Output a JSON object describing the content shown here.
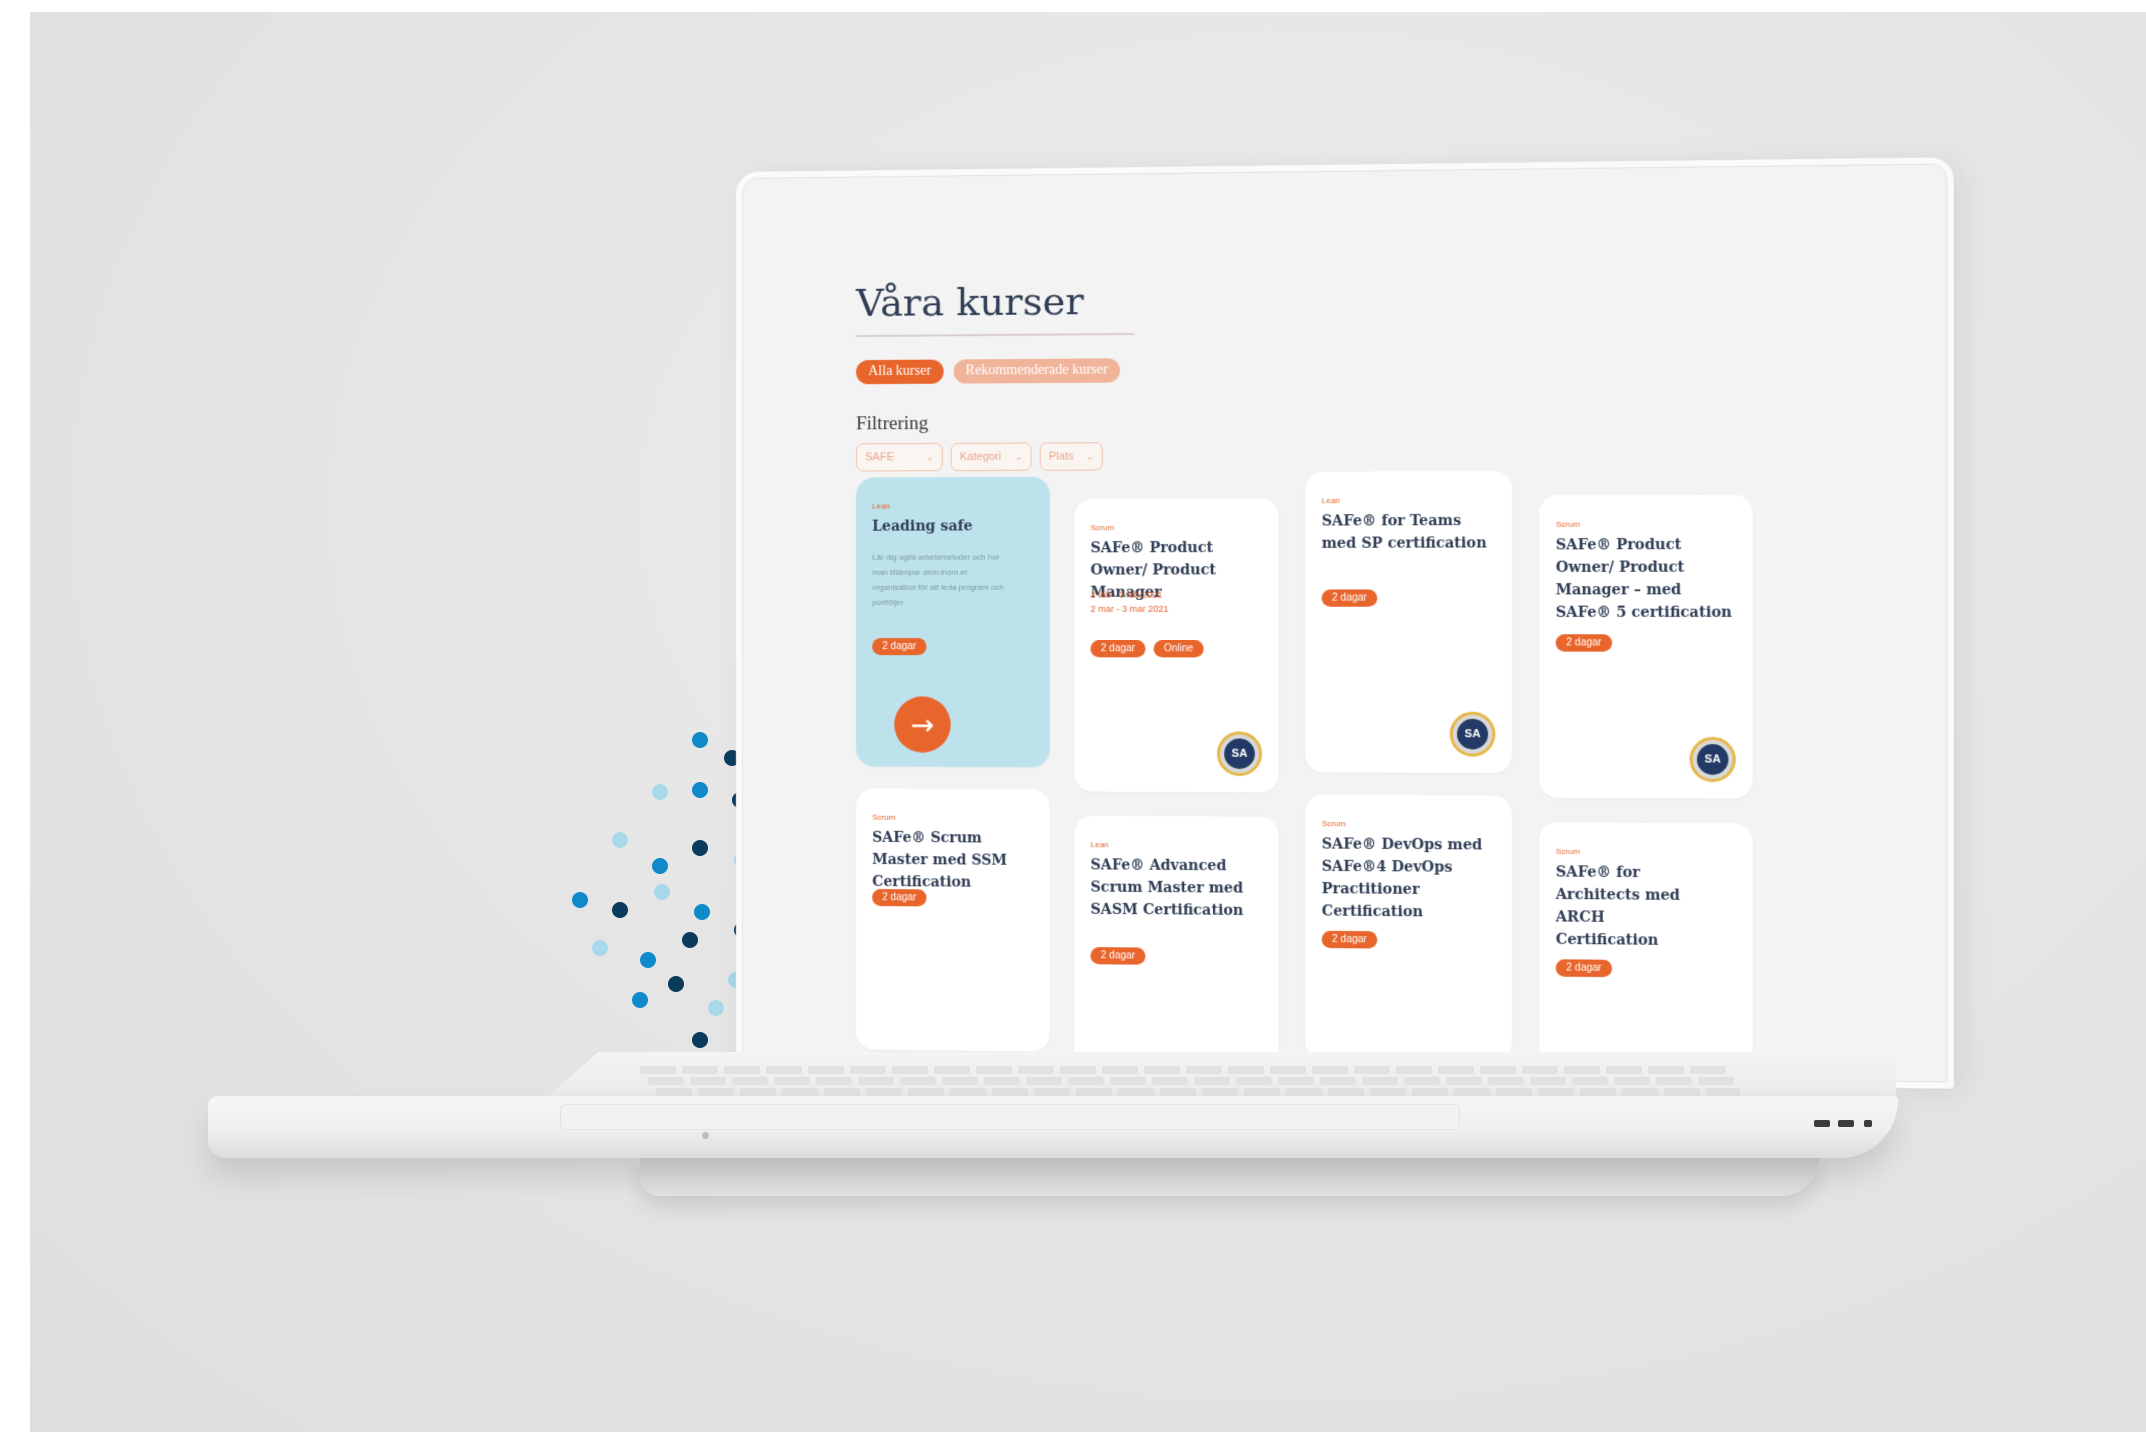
{
  "page": {
    "title": "Våra kurser",
    "tabs": [
      {
        "label": "Alla kurser",
        "active": true
      },
      {
        "label": "Rekommenderade kurser",
        "active": false
      }
    ],
    "filter_label": "Filtrering",
    "filters": [
      {
        "value": "SAFE"
      },
      {
        "value": "Kategori"
      },
      {
        "value": "Plats"
      }
    ]
  },
  "cards": [
    {
      "category": "Lean",
      "title": "Leading safe",
      "description": "Lär dig agila arbetsmetoder och hur man tillämpar dem inom er organisation för att leda program och portföljer",
      "badges": [
        "2 dagar"
      ],
      "featured": true,
      "action_icon": "arrow-right-icon"
    },
    {
      "category": "Scrum",
      "title": "SAFe® Product Owner/ Product Manager",
      "dates": [
        "2 feb - 3 feb 2021",
        "2 mar - 3 mar 2021"
      ],
      "badges": [
        "2 dagar",
        "Online"
      ],
      "cert": "SA"
    },
    {
      "category": "Lean",
      "title": "SAFe® for Teams med SP certification",
      "badges": [
        "2 dagar"
      ],
      "cert": "SA"
    },
    {
      "category": "Scrum",
      "title": "SAFe® Product Owner/ Product Manager – med SAFe® 5 certification",
      "badges": [
        "2 dagar"
      ],
      "cert": "SA"
    },
    {
      "category": "Scrum",
      "title": "SAFe® Scrum Master med SSM Certification",
      "badges": [
        "2 dagar"
      ]
    },
    {
      "category": "Lean",
      "title": "SAFe® Advanced Scrum Master med SASM Certification",
      "badges": [
        "2 dagar"
      ]
    },
    {
      "category": "Scrum",
      "title": "SAFe® DevOps med SAFe®4 DevOps Practitioner Certification",
      "badges": [
        "2 dagar"
      ]
    },
    {
      "category": "Scrum",
      "title": "SAFe® for Architects med ARCH Certification",
      "badges": [
        "2 dagar"
      ]
    }
  ],
  "colors": {
    "accent": "#e8652c",
    "accent_light": "#f0b49a",
    "title_text": "#2f3d55",
    "featured_card": "#bde2ec",
    "dots": [
      "#0f89c9",
      "#0b3b5c",
      "#a8d8ea"
    ]
  },
  "icons": {
    "dropdown": "chevron-down-icon",
    "badge": "certification-badge-icon",
    "arrow": "arrow-right-icon"
  }
}
